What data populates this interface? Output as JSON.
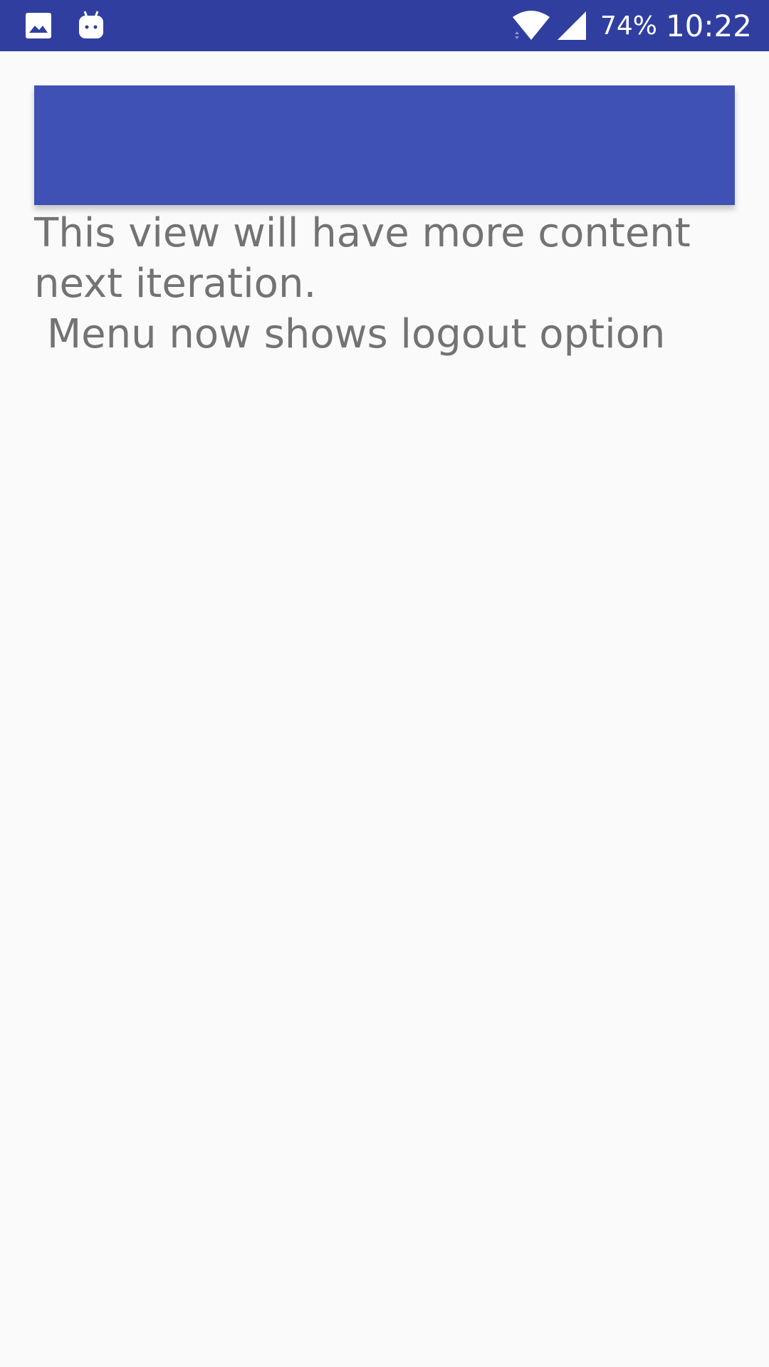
{
  "status_bar": {
    "left_icons": [
      "gallery-notification-icon",
      "android-notification-icon"
    ],
    "right_icons": [
      "wifi-icon",
      "cell-signal-icon"
    ],
    "battery": "74%",
    "time": "10:22",
    "background_color": "#303f9f"
  },
  "toolbar": {
    "color": "#3f51b5"
  },
  "content": {
    "message": "This view will have more content next iteration.\n Menu now shows logout option"
  }
}
